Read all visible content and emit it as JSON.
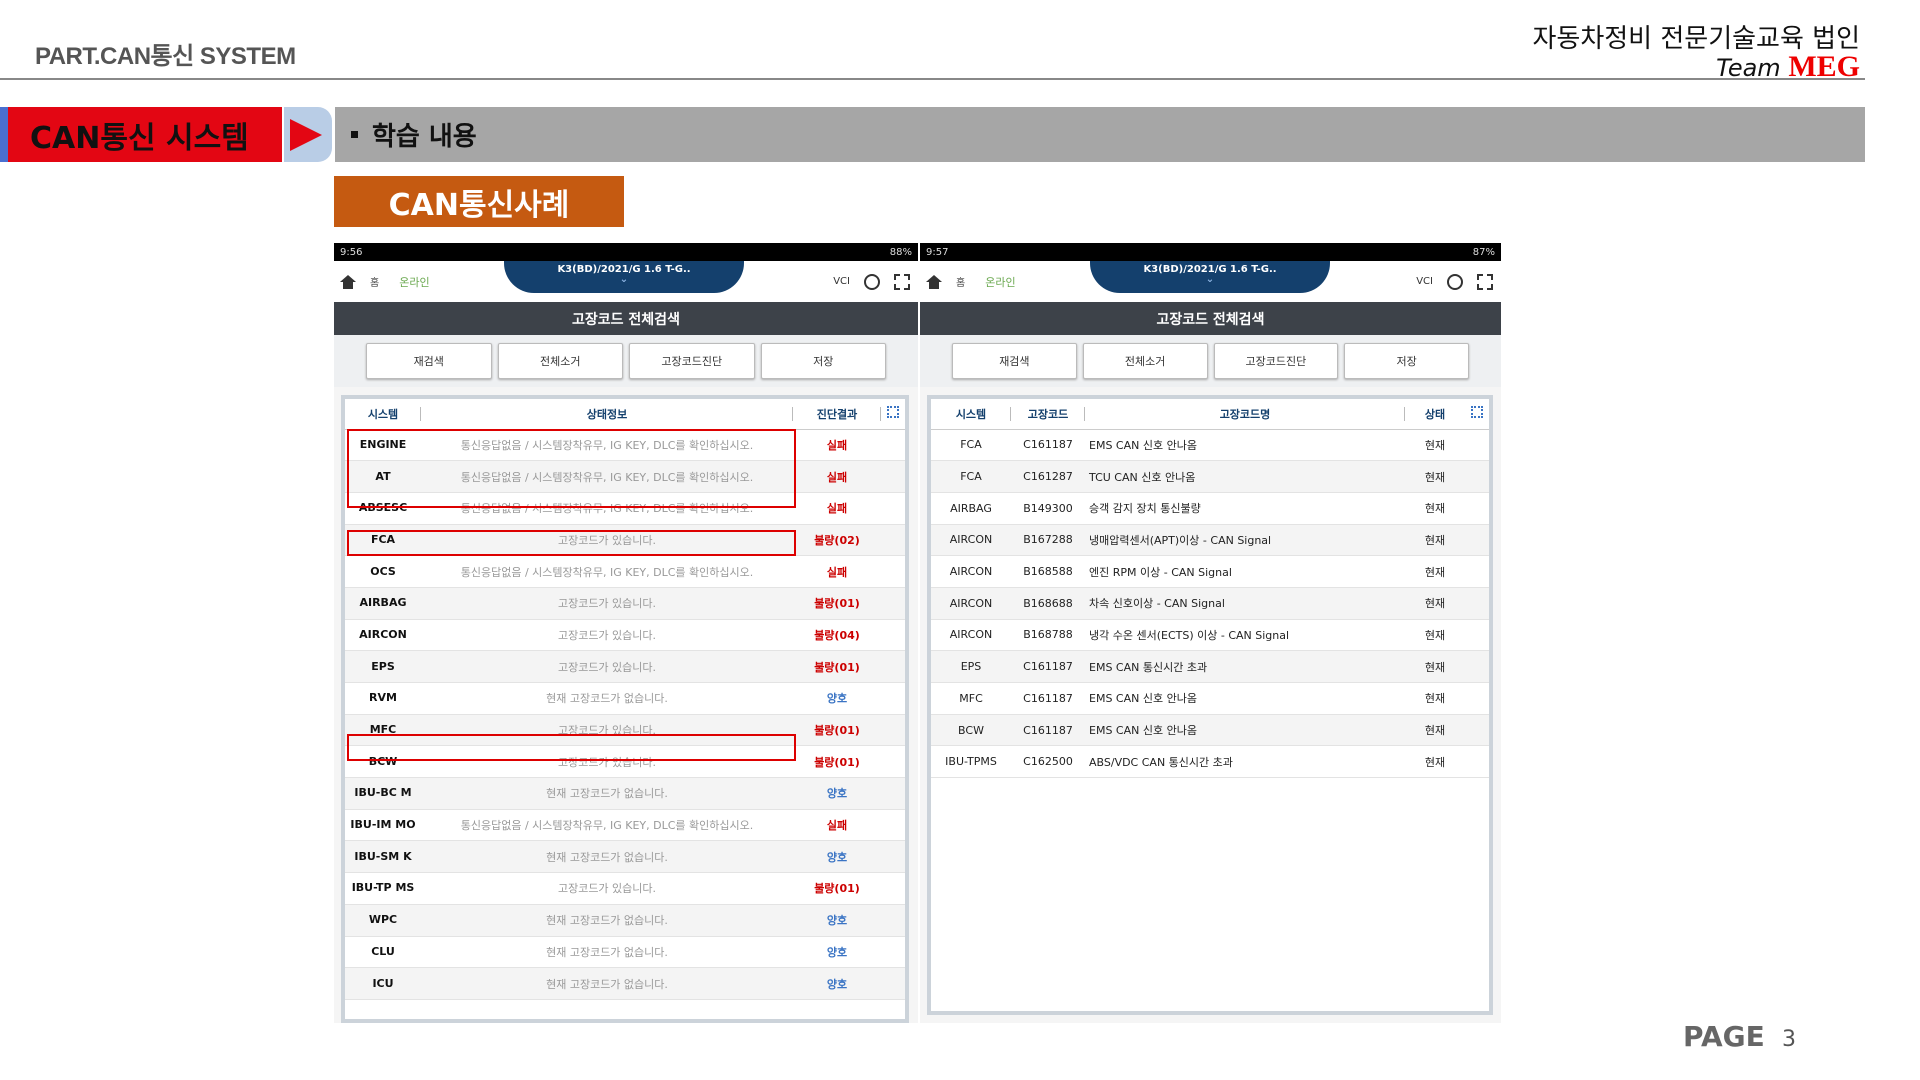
{
  "header": {
    "part_title": "PART.CAN통신 SYSTEM",
    "org": "자동차정비 전문기술교육 법인",
    "team_prefix": "Team ",
    "team_brand": "MEG"
  },
  "section": {
    "tab_label": "CAN통신 시스템",
    "bar_label": "학습 내용",
    "case_badge": "CAN통신사례"
  },
  "left_phone": {
    "status_time": "9:56",
    "status_right": "88%",
    "home_label": "홈",
    "online_label": "온라인",
    "vehicle": "K3(BD)/2021/G 1.6 T-G..",
    "vci": "VCI",
    "screen_title": "고장코드 전체검색",
    "buttons": [
      "재검색",
      "전체소거",
      "고장코드진단",
      "저장"
    ],
    "columns": [
      "시스템",
      "상태정보",
      "진단결과"
    ],
    "rows": [
      {
        "system": "ENGINE",
        "info": "통신응답없음 / 시스템장착유무, IG KEY, DLC를 확인하십시오.",
        "result": "실패",
        "status": "fail"
      },
      {
        "system": "AT",
        "info": "통신응답없음 / 시스템장착유무, IG KEY, DLC를 확인하십시오.",
        "result": "실패",
        "status": "fail"
      },
      {
        "system": "ABSESC",
        "info": "통신응답없음 / 시스템장착유무, IG KEY, DLC를 확인하십시오.",
        "result": "실패",
        "status": "fail"
      },
      {
        "system": "FCA",
        "info": "고장코드가 있습니다.",
        "result": "불량(02)",
        "status": "fail"
      },
      {
        "system": "OCS",
        "info": "통신응답없음 / 시스템장착유무, IG KEY, DLC를 확인하십시오.",
        "result": "실패",
        "status": "fail"
      },
      {
        "system": "AIRBAG",
        "info": "고장코드가 있습니다.",
        "result": "불량(01)",
        "status": "fail"
      },
      {
        "system": "AIRCON",
        "info": "고장코드가 있습니다.",
        "result": "불량(04)",
        "status": "fail"
      },
      {
        "system": "EPS",
        "info": "고장코드가 있습니다.",
        "result": "불량(01)",
        "status": "fail"
      },
      {
        "system": "RVM",
        "info": "현재 고장코드가 없습니다.",
        "result": "양호",
        "status": "ok"
      },
      {
        "system": "MFC",
        "info": "고장코드가 있습니다.",
        "result": "불량(01)",
        "status": "fail"
      },
      {
        "system": "BCW",
        "info": "고장코드가 있습니다.",
        "result": "불량(01)",
        "status": "fail"
      },
      {
        "system": "IBU-BC M",
        "info": "현재 고장코드가 없습니다.",
        "result": "양호",
        "status": "ok"
      },
      {
        "system": "IBU-IM MO",
        "info": "통신응답없음 / 시스템장착유무, IG KEY, DLC를 확인하십시오.",
        "result": "실패",
        "status": "fail"
      },
      {
        "system": "IBU-SM K",
        "info": "현재 고장코드가 없습니다.",
        "result": "양호",
        "status": "ok"
      },
      {
        "system": "IBU-TP MS",
        "info": "고장코드가 있습니다.",
        "result": "불량(01)",
        "status": "fail"
      },
      {
        "system": "WPC",
        "info": "현재 고장코드가 없습니다.",
        "result": "양호",
        "status": "ok"
      },
      {
        "system": "CLU",
        "info": "현재 고장코드가 없습니다.",
        "result": "양호",
        "status": "ok"
      },
      {
        "system": "ICU",
        "info": "현재 고장코드가 없습니다.",
        "result": "양호",
        "status": "ok"
      }
    ]
  },
  "right_phone": {
    "status_time": "9:57",
    "status_right": "87%",
    "home_label": "홈",
    "online_label": "온라인",
    "vehicle": "K3(BD)/2021/G 1.6 T-G..",
    "vci": "VCI",
    "screen_title": "고장코드 전체검색",
    "buttons": [
      "재검색",
      "전체소거",
      "고장코드진단",
      "저장"
    ],
    "columns": [
      "시스템",
      "고장코드",
      "고장코드명",
      "상태"
    ],
    "rows": [
      {
        "system": "FCA",
        "code": "C161187",
        "name": "EMS CAN 신호 안나옴",
        "state": "현재"
      },
      {
        "system": "FCA",
        "code": "C161287",
        "name": "TCU CAN 신호 안나옴",
        "state": "현재"
      },
      {
        "system": "AIRBAG",
        "code": "B149300",
        "name": "승객 감지 장치 통신불량",
        "state": "현재"
      },
      {
        "system": "AIRCON",
        "code": "B167288",
        "name": "냉매압력센서(APT)이상 - CAN Signal",
        "state": "현재"
      },
      {
        "system": "AIRCON",
        "code": "B168588",
        "name": "엔진 RPM 이상 - CAN Signal",
        "state": "현재"
      },
      {
        "system": "AIRCON",
        "code": "B168688",
        "name": "차속 신호이상 - CAN Signal",
        "state": "현재"
      },
      {
        "system": "AIRCON",
        "code": "B168788",
        "name": "냉각 수온 센서(ECTS) 이상 - CAN Signal",
        "state": "현재"
      },
      {
        "system": "EPS",
        "code": "C161187",
        "name": "EMS CAN 통신시간 초과",
        "state": "현재"
      },
      {
        "system": "MFC",
        "code": "C161187",
        "name": "EMS CAN 신호 안나옴",
        "state": "현재"
      },
      {
        "system": "BCW",
        "code": "C161187",
        "name": "EMS CAN 신호 안나옴",
        "state": "현재"
      },
      {
        "system": "IBU-TPMS",
        "code": "C162500",
        "name": "ABS/VDC CAN 통신시간 초과",
        "state": "현재"
      }
    ]
  },
  "footer": {
    "page_label": "PAGE",
    "page_number": "3"
  },
  "colors": {
    "accent_red": "#e30613",
    "badge_orange": "#c55a11",
    "navy": "#14406d",
    "fail": "#cc0000",
    "ok": "#3a74c4"
  }
}
